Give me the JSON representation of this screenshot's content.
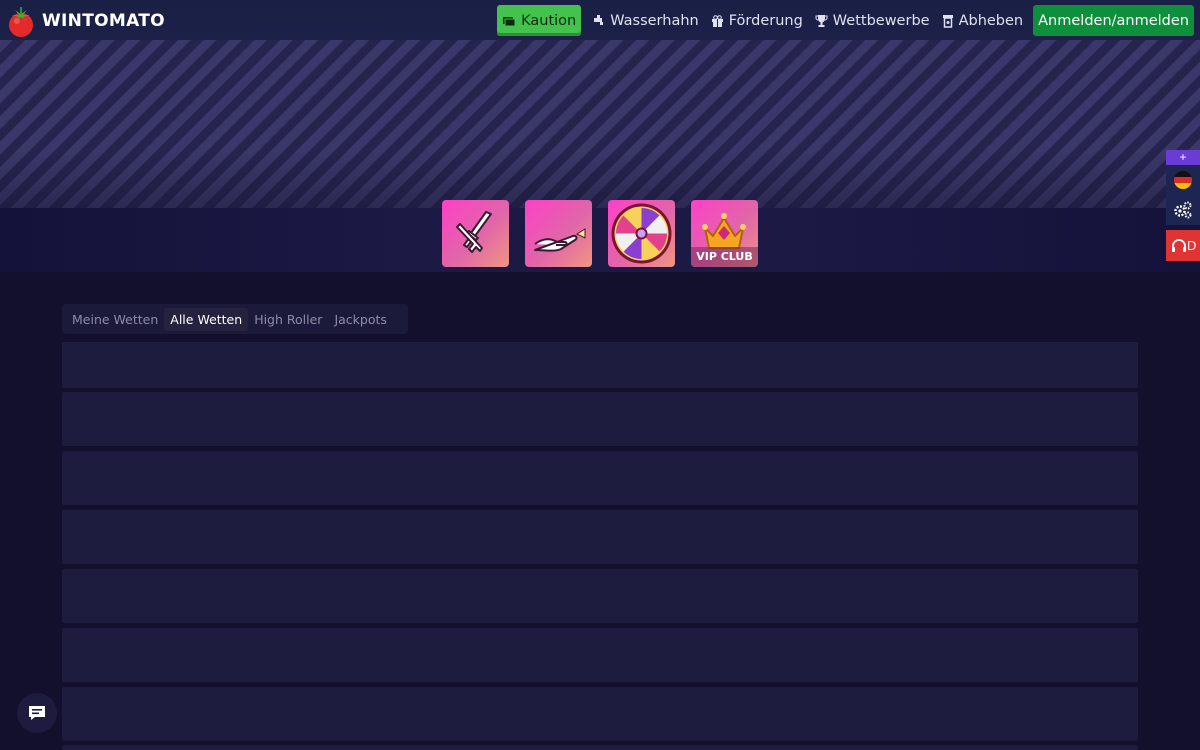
{
  "brand": {
    "name": "WINTOMATO"
  },
  "nav": {
    "deposit": "Kaution",
    "faucet": "Wasserhahn",
    "promotion": "Förderung",
    "contests": "Wettbewerbe",
    "withdraw": "Abheben",
    "login": "Anmelden/anmelden"
  },
  "games": {
    "vip_label": "VIP CLUB"
  },
  "side": {
    "plus": "+",
    "support_letter": "D"
  },
  "bets_tabs": [
    "Meine Wetten",
    "Alle Wetten",
    "High Roller",
    "Jackpots"
  ],
  "active_tab": "Alle Wetten",
  "colors": {
    "accent_green": "#43c24e",
    "login_green": "#0e8f3c",
    "tile_pink": "#ff3fc8",
    "background": "#12102c",
    "support_red": "#e03434",
    "side_purple": "#6b3bd6"
  }
}
